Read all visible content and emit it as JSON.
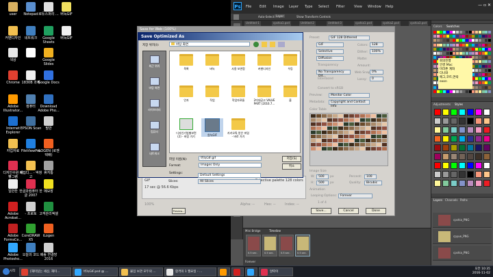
{
  "desktop": {
    "icons": [
      {
        "label": "user",
        "color": "#d8b060"
      },
      {
        "label": "Notepad",
        "color": "#5a8fd0"
      },
      {
        "label": "로듀스퍼리 ...",
        "color": "#e0e0e0"
      },
      {
        "label": "버녹GIF",
        "color": "#f0e060"
      },
      {
        "label": "커벤디자인",
        "color": "#f2c050"
      },
      {
        "label": "네트워크",
        "color": "#4080c0"
      },
      {
        "label": "Google Sheets",
        "color": "#20a060"
      },
      {
        "label": "버녹GIF",
        "color": "#f0f0f0"
      },
      {
        "label": "색상",
        "color": "#e8e8e8"
      },
      {
        "label": "",
        "color": "#ffffff"
      },
      {
        "label": "Google Slides",
        "color": "#f0b020"
      },
      {
        "label": "Chrome",
        "color": "#e04030"
      },
      {
        "label": "1830B 과제",
        "color": "#f0f0f0"
      },
      {
        "label": "Google Docs",
        "color": "#3070e0"
      },
      {
        "label": "Adobe Illustrator...",
        "color": "#ff9a00"
      },
      {
        "label": "컴퓨터",
        "color": "#5080b0"
      },
      {
        "label": "Download Adobe Pho...",
        "color": "#3070c0"
      },
      {
        "label": "Internet Explorer",
        "color": "#1c6fd0"
      },
      {
        "label": "EPSON Scan",
        "color": "#4070a0"
      },
      {
        "label": "필반",
        "color": "#d0d0d0"
      },
      {
        "label": "자업자료",
        "color": "#f2c050"
      },
      {
        "label": "FileViewPro",
        "color": "#2080e0"
      },
      {
        "label": "iLOGEN (로젠택배)",
        "color": "#f06020"
      },
      {
        "label": "디자인수원 새 빵그램",
        "color": "#e03050"
      },
      {
        "label": "떼집디... - 박창고",
        "color": "#f2c050"
      },
      {
        "label": "휴지통",
        "color": "#a0a0a0"
      },
      {
        "label": "일반찬",
        "color": "#f0f0f0"
      },
      {
        "label": "한글과컴퓨터 한글 2007",
        "color": "#e03050"
      },
      {
        "label": "메모장",
        "color": "#f0e020"
      },
      {
        "label": "Adobe Acrobat...",
        "color": "#d02020"
      },
      {
        "label": "- 프로토",
        "color": "#d0d0d0"
      },
      {
        "label": "고객관리엑셀",
        "color": "#209040"
      },
      {
        "label": "Adobe FormsCe...",
        "color": "#c02020"
      },
      {
        "label": "CoreDRAW X5",
        "color": "#30a030"
      },
      {
        "label": "iLogen",
        "color": "#f06020"
      },
      {
        "label": "Adobe Photosho...",
        "color": "#31a8ff"
      },
      {
        "label": "오늘의 코드",
        "color": "#4080c0"
      },
      {
        "label": "배송 연결방 2016",
        "color": "#d0d0d0"
      }
    ]
  },
  "photoshop": {
    "logo": "Ps",
    "menu": [
      "File",
      "Edit",
      "Image",
      "Layer",
      "Type",
      "Select",
      "Filter",
      "View",
      "Window",
      "Help"
    ],
    "options": {
      "auto_select": "Auto-Select:",
      "layer": "Layer",
      "show_transform": "Show Transform Controls"
    },
    "tabs": [
      "Untitled-1",
      "cpshia1.psd",
      "Untitled-2",
      "Untitled-3",
      "cpshia1.psd",
      "cpshia2.psd",
      "cpshia3.psd"
    ],
    "right_panels": {
      "colors": "Colors",
      "swatches": "Swatches",
      "adjustments": "Adjustments",
      "styles": "Styles",
      "layers": "Layers",
      "channels": "Channels",
      "paths": "Paths",
      "actions": "Actions",
      "history": "History"
    },
    "layers": [
      "cpshia_PNG",
      "cpyue_PNG",
      "cpshia_PNG"
    ],
    "sticky": [
      "회의진행",
      "안경 Mac",
      "미라촌 계좌",
      "다나와",
      "메그,코트,연락",
      "exon"
    ],
    "timeline": {
      "label": "Timeline",
      "mini_bridge": "Mini Bridge",
      "frame_delay": "0.5 sec.",
      "forever": "Forever"
    }
  },
  "save_for_web": {
    "title": "Save for Web (100%)",
    "preset_label": "Preset:",
    "preset": "GIF 128 Dithered",
    "format": "GIF",
    "reduction": "Selective",
    "dither_algo": "Diffusion",
    "transparency": "Transparency",
    "matte": "No Transparency Dit...",
    "interlaced": "Interlaced",
    "colors_label": "Colors:",
    "colors": "128",
    "dither_label": "Dither:",
    "dither": "100%",
    "matte_label": "Matte:",
    "amount_label": "Amount:",
    "web_snap_label": "Web Snap:",
    "web_snap": "0%",
    "lossy_label": "Lossy:",
    "lossy": "0",
    "convert_srgb": "Convert to sRGB",
    "preview_label": "Preview:",
    "preview": "Monitor Color",
    "metadata_label": "Metadata:",
    "metadata": "Copyright and Contact Info",
    "color_table": "Color Table",
    "image_size": "Image Size",
    "w_label": "W:",
    "w": "500",
    "h_label": "H:",
    "h": "500",
    "px": "px",
    "percent_label": "Percent:",
    "percent": "100",
    "quality_label": "Quality:",
    "quality": "Bicubic",
    "animation": "Animation",
    "looping_label": "Looping Options:",
    "looping": "Forever",
    "frame_counter": "1 of 4",
    "preview_info_left": "GIF",
    "preview_info_size": "17 sec @ 56.6 Kbps",
    "preview_info_right": "Selective palette  128 colors",
    "zoom": "100%",
    "alpha": "Alpha: --",
    "hex": "Hex: --",
    "index": "Index: --",
    "save_btn": "Save...",
    "cancel_btn": "Cancel",
    "done_btn": "Done",
    "preview_btn": "Preview...",
    "doc_info": "Doc: 732.4K/2.78M"
  },
  "save_dialog": {
    "title": "Save Optimized As",
    "location_label": "저장 위치(I):",
    "location": "바탕 화면",
    "places": [
      "최근 위치",
      "바탕 화면",
      "라이브러리",
      "컴퓨터",
      "네트워크"
    ],
    "files": [
      "목록",
      "버녹",
      "사용 보관함",
      "커벤디자인",
      "우등",
      "인자",
      "작업",
      "작업자료들",
      "2미대공고 VALVE PART (2016.7...",
      "출",
      "디자인기법별보면 (2) - 바탕 가기",
      "원녹GIF",
      "카카오톡 받은 파일 - 바로 가기"
    ],
    "filename_label": "파일 이름(N):",
    "filename": "버녹GIF.gif",
    "format_label": "Format:",
    "format": "Images Only",
    "settings_label": "Settings:",
    "settings": "Default Settings",
    "slices_label": "Slices:",
    "slices": "All Slices",
    "save_btn": "저장(S)",
    "cancel_btn": "취소"
  },
  "taskbar": {
    "start": "시작",
    "items": [
      {
        "label": "[재미있는 세상, 재미...",
        "color": "#e04030"
      },
      {
        "label": "버녹GIF.psd @ ...",
        "color": "#31a8ff"
      },
      {
        "label": "불임 보관 모두의 ...",
        "color": "#f2c050"
      },
      {
        "label": "합격의 1 월요일 - ...",
        "color": "#e8e8e8"
      },
      {
        "label": "",
        "color": "#ff9a00"
      },
      {
        "label": "",
        "color": "#d02020"
      },
      {
        "label": "",
        "color": "#31a8ff"
      },
      {
        "label": "알따이",
        "color": "#e03050"
      }
    ],
    "clock_time": "오전 10:35",
    "clock_date": "2016-11-02"
  }
}
